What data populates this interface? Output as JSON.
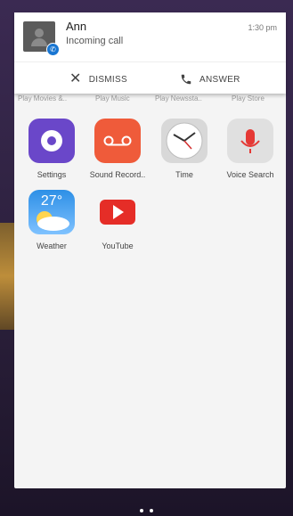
{
  "notification": {
    "name": "Ann",
    "status": "Incoming call",
    "time": "1:30 pm",
    "actions": {
      "dismiss": "DISMISS",
      "answer": "ANSWER"
    }
  },
  "app_labels_row": [
    "Play Movies &..",
    "Play Music",
    "Play Newssta..",
    "Play Store"
  ],
  "apps": [
    {
      "label": "Settings"
    },
    {
      "label": "Sound Record.."
    },
    {
      "label": "Time"
    },
    {
      "label": "Voice Search"
    },
    {
      "label": "Weather",
      "temp": "27°"
    },
    {
      "label": "YouTube"
    }
  ],
  "colors": {
    "settings": "#6a47c9",
    "sound_recorder": "#ef5b3a",
    "youtube": "#e52d27",
    "weather": "#2d8fe6",
    "answer_icon": "#444444"
  }
}
